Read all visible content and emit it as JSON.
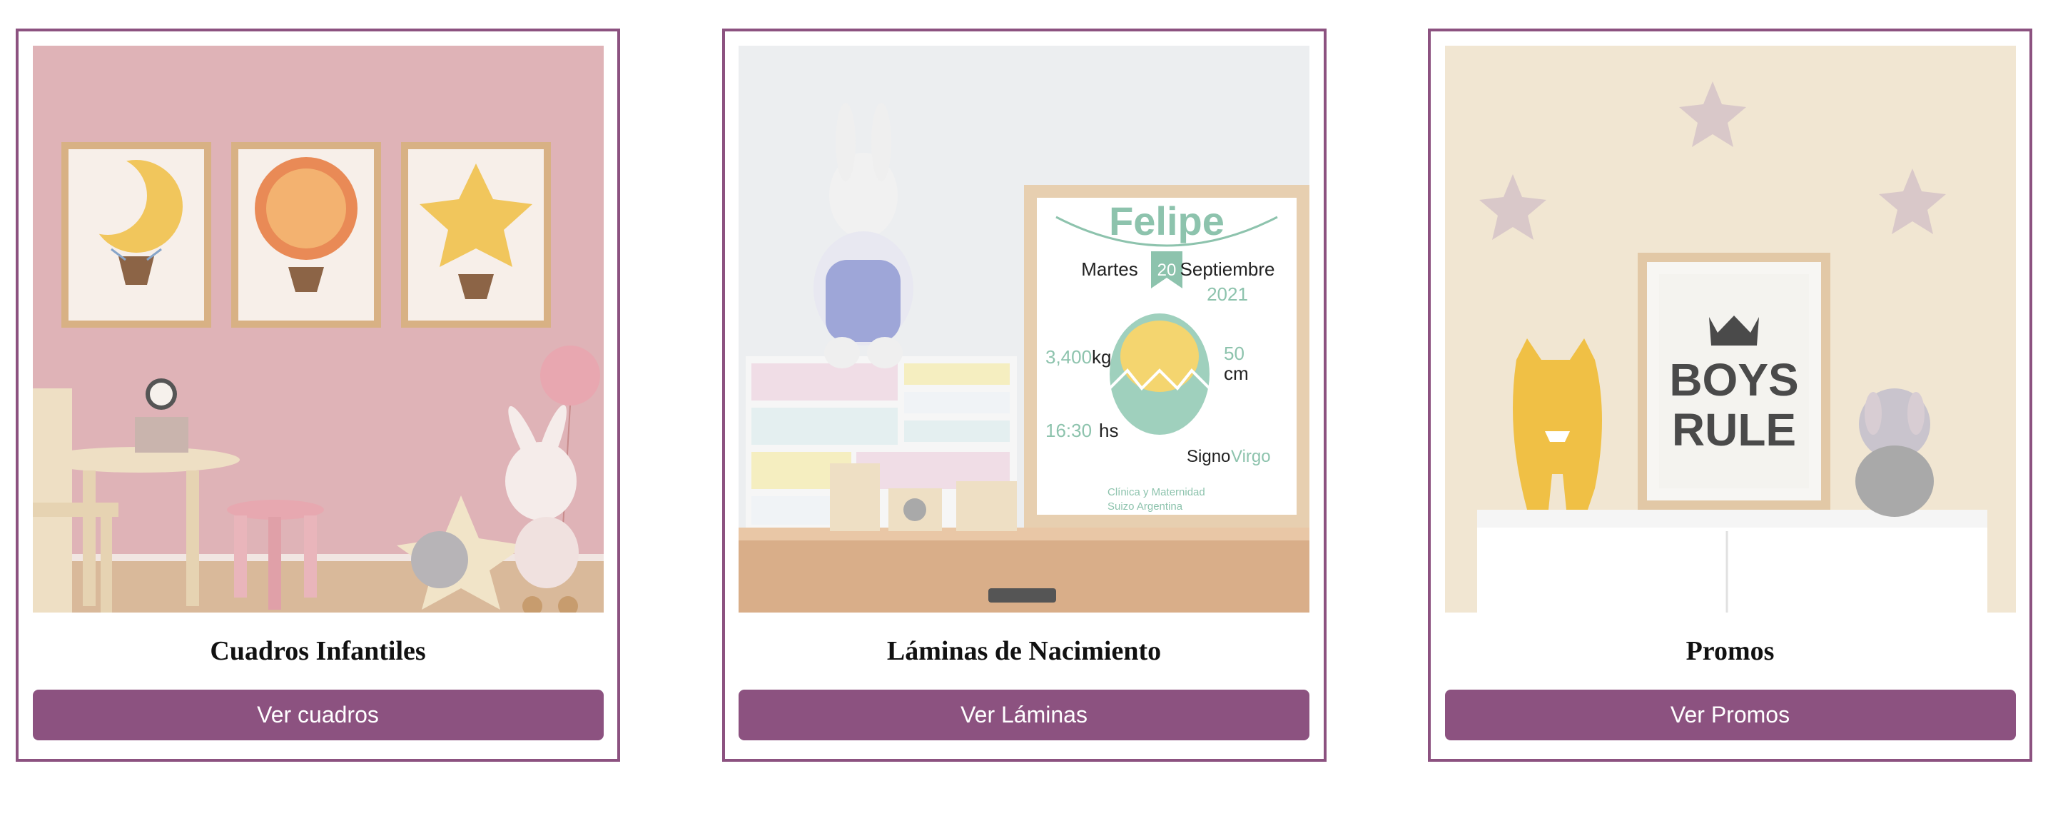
{
  "colors": {
    "accent": "#8c5280",
    "button_text": "#ffffff"
  },
  "cards": [
    {
      "title": "Cuadros Infantiles",
      "button_label": "Ver cuadros",
      "image_alt": "Nursery with three framed prints: moon, sun and star hot air balloons"
    },
    {
      "title": "Láminas de Nacimiento",
      "button_label": "Ver Láminas",
      "image_alt": "Birth print frame next to a plush bunny and drawer chest",
      "image_text": {
        "name": "Felipe",
        "weekday": "Martes",
        "day": "20",
        "month": "Septiembre",
        "year": "2021",
        "weight_value": "3,400",
        "weight_unit": "kg",
        "length_value": "50",
        "length_unit": "cm",
        "time_value": "16:30",
        "time_unit": "hs",
        "sign_label": "Signo",
        "sign_value": "Virgo",
        "clinic_line1": "Clínica y Maternidad",
        "clinic_line2": "Suizo Argentina"
      }
    },
    {
      "title": "Promos",
      "button_label": "Ver Promos",
      "image_alt": "Shelf with Boys Rule print, yellow monster plush and stars",
      "image_text": {
        "line1": "BOYS",
        "line2": "RULE"
      }
    }
  ]
}
